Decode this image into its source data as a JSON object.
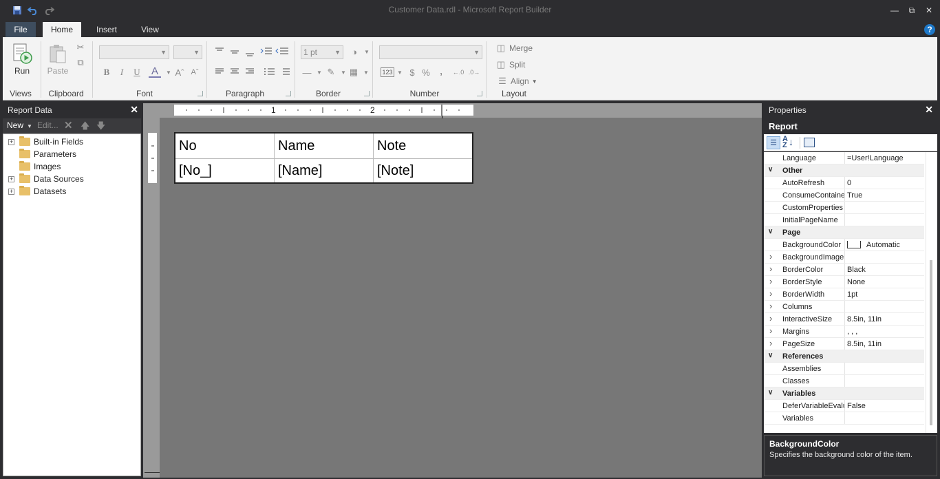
{
  "window": {
    "title": "Customer Data.rdl - Microsoft Report Builder"
  },
  "ribbon": {
    "tabs": [
      "File",
      "Home",
      "Insert",
      "View"
    ],
    "active_tab": "Home",
    "help": "?",
    "groups": {
      "views": {
        "label": "Views",
        "run": "Run"
      },
      "clipboard": {
        "label": "Clipboard",
        "paste": "Paste"
      },
      "font": {
        "label": "Font",
        "bold": "B",
        "italic": "I",
        "underline": "U",
        "color": "A"
      },
      "paragraph": {
        "label": "Paragraph"
      },
      "border": {
        "label": "Border",
        "width": "1 pt"
      },
      "number": {
        "label": "Number",
        "placeholders": "123",
        "currency": "$",
        "percent": "%",
        "comma": ","
      },
      "layout": {
        "label": "Layout",
        "merge": "Merge",
        "split": "Split",
        "align": "Align"
      }
    }
  },
  "report_data": {
    "title": "Report Data",
    "close": "✕",
    "toolbar": {
      "new": "New",
      "edit": "Edit..."
    },
    "items": [
      {
        "label": "Built-in Fields",
        "expandable": true
      },
      {
        "label": "Parameters",
        "expandable": false
      },
      {
        "label": "Images",
        "expandable": false
      },
      {
        "label": "Data Sources",
        "expandable": true
      },
      {
        "label": "Datasets",
        "expandable": true
      }
    ]
  },
  "ruler": {
    "marks": [
      "1",
      "2"
    ]
  },
  "table": {
    "headers": [
      "No",
      "Name",
      "Note"
    ],
    "row": [
      "[No_]",
      "[Name]",
      "[Note]"
    ]
  },
  "properties": {
    "title": "Properties",
    "close": "✕",
    "object": "Report",
    "rows": [
      {
        "type": "prop",
        "name": "Language",
        "value": "=User!Language"
      },
      {
        "type": "cat",
        "name": "Other"
      },
      {
        "type": "prop",
        "name": "AutoRefresh",
        "value": "0"
      },
      {
        "type": "prop",
        "name": "ConsumeContainerWhitespace",
        "value": "True"
      },
      {
        "type": "prop",
        "name": "CustomProperties",
        "value": ""
      },
      {
        "type": "prop",
        "name": "InitialPageName",
        "value": ""
      },
      {
        "type": "cat",
        "name": "Page"
      },
      {
        "type": "prop",
        "name": "BackgroundColor",
        "value": "Automatic",
        "swatch": "#ffffff"
      },
      {
        "type": "prop",
        "name": "BackgroundImage",
        "value": "",
        "expand": true
      },
      {
        "type": "prop",
        "name": "BorderColor",
        "value": "Black",
        "expand": true
      },
      {
        "type": "prop",
        "name": "BorderStyle",
        "value": "None",
        "expand": true
      },
      {
        "type": "prop",
        "name": "BorderWidth",
        "value": "1pt",
        "expand": true
      },
      {
        "type": "prop",
        "name": "Columns",
        "value": "",
        "expand": true
      },
      {
        "type": "prop",
        "name": "InteractiveSize",
        "value": "8.5in, 11in",
        "expand": true
      },
      {
        "type": "prop",
        "name": "Margins",
        "value": ", , ,",
        "expand": true
      },
      {
        "type": "prop",
        "name": "PageSize",
        "value": "8.5in, 11in",
        "expand": true
      },
      {
        "type": "cat",
        "name": "References"
      },
      {
        "type": "prop",
        "name": "Assemblies",
        "value": ""
      },
      {
        "type": "prop",
        "name": "Classes",
        "value": ""
      },
      {
        "type": "cat",
        "name": "Variables"
      },
      {
        "type": "prop",
        "name": "DeferVariableEvaluation",
        "value": "False"
      },
      {
        "type": "prop",
        "name": "Variables",
        "value": ""
      }
    ],
    "description": {
      "title": "BackgroundColor",
      "text": "Specifies the background color of the item."
    }
  }
}
